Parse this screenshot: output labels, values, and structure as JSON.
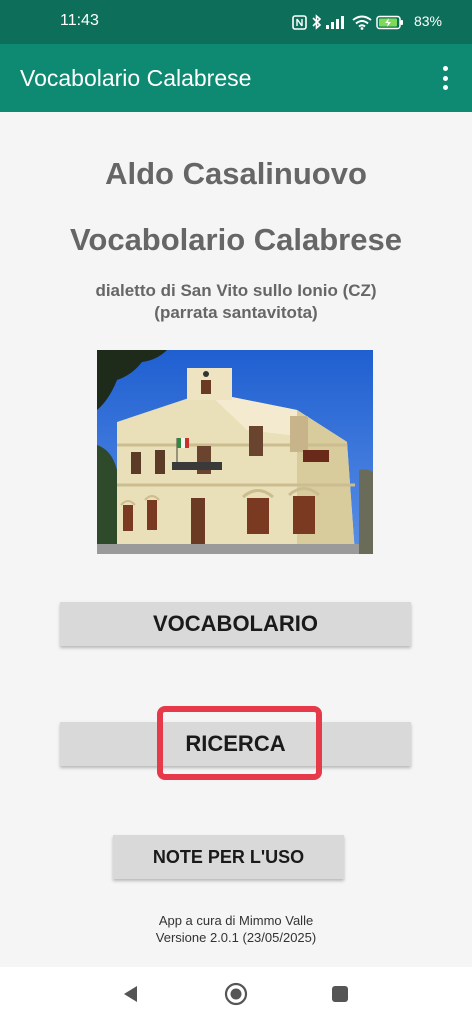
{
  "status_bar": {
    "time": "11:43",
    "battery_percent": "83%",
    "icons": [
      "nfc-icon",
      "bluetooth-icon",
      "signal-icon",
      "wifi-icon",
      "battery-charging-icon"
    ]
  },
  "app_bar": {
    "title": "Vocabolario Calabrese",
    "menu_icon": "more-vert-icon"
  },
  "main": {
    "author": "Aldo Casalinuovo",
    "title": "Vocabolario Calabrese",
    "subtitle_line1": "dialetto di San Vito sullo Ionio (CZ)",
    "subtitle_line2": "(parrata santavitota)",
    "buttons": {
      "vocabolario": "VOCABOLARIO",
      "ricerca": "RICERCA",
      "note": "NOTE PER L'USO"
    },
    "credits_line1": "App a cura di Mimmo Valle",
    "credits_line2": "Versione 2.0.1 (23/05/2025)"
  },
  "highlight_color": "#e63a4a",
  "colors": {
    "status_bar": "#0d6e5a",
    "app_bar": "#0e8a72",
    "button_bg": "#d9d9d9",
    "heading_text": "#666666"
  },
  "nav_bar": {
    "icons": [
      "back-icon",
      "home-icon",
      "recents-icon"
    ]
  }
}
